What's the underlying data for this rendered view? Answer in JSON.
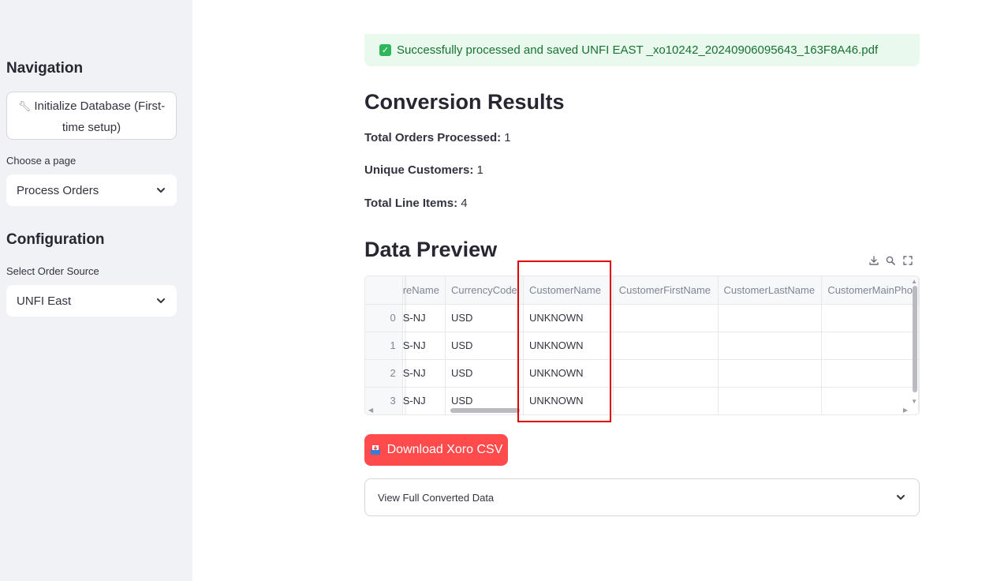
{
  "sidebar": {
    "navigation_heading": "Navigation",
    "init_button": "Initialize Database (First-time setup)",
    "page_label": "Choose a page",
    "page_value": "Process Orders",
    "configuration_heading": "Configuration",
    "source_label": "Select Order Source",
    "source_value": "UNFI East"
  },
  "alert": {
    "text": "Successfully processed and saved UNFI EAST _xo10242_20240906095643_163F8A46.pdf",
    "status_color": "#2fb65a"
  },
  "results": {
    "heading": "Conversion Results",
    "stats": [
      {
        "label": "Total Orders Processed:",
        "value": "1"
      },
      {
        "label": "Unique Customers:",
        "value": "1"
      },
      {
        "label": "Total Line Items:",
        "value": "4"
      }
    ]
  },
  "preview": {
    "heading": "Data Preview",
    "columns": [
      "reName",
      "CurrencyCode",
      "CustomerName",
      "CustomerFirstName",
      "CustomerLastName",
      "CustomerMainPho"
    ],
    "rows": [
      {
        "index": "0",
        "cells": [
          "S-NJ",
          "USD",
          "UNKNOWN",
          "",
          "",
          ""
        ]
      },
      {
        "index": "1",
        "cells": [
          "S-NJ",
          "USD",
          "UNKNOWN",
          "",
          "",
          ""
        ]
      },
      {
        "index": "2",
        "cells": [
          "S-NJ",
          "USD",
          "UNKNOWN",
          "",
          "",
          ""
        ]
      },
      {
        "index": "3",
        "cells": [
          "S-NJ",
          "USD",
          "UNKNOWN",
          "",
          "",
          ""
        ]
      }
    ],
    "highlight_color": "#e00000"
  },
  "download": {
    "label": "Download Xoro CSV",
    "color": "#ff4b4b"
  },
  "expander": {
    "label": "View Full Converted Data"
  }
}
